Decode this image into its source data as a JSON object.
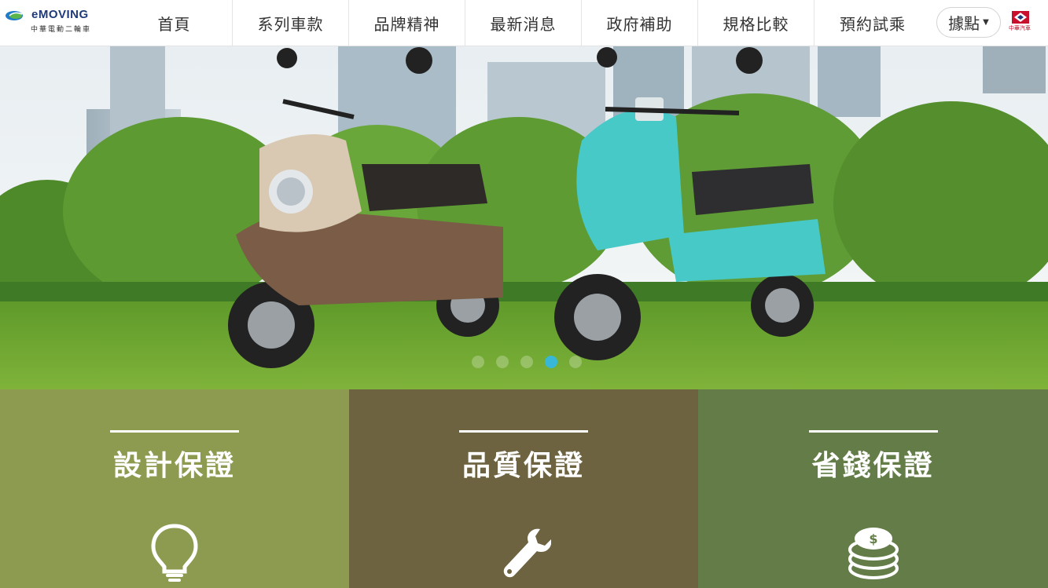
{
  "header": {
    "logo_text": "eMOVING",
    "logo_subtitle": "中華電動二輪車",
    "nav": [
      {
        "label": "首頁"
      },
      {
        "label": "系列車款"
      },
      {
        "label": "品牌精神"
      },
      {
        "label": "最新消息"
      },
      {
        "label": "政府補助"
      },
      {
        "label": "規格比較"
      },
      {
        "label": "預約試乘"
      }
    ],
    "locate_label": "據點",
    "partner_logo_text": "中華汽車"
  },
  "hero": {
    "slide_count": 5,
    "active_slide": 4
  },
  "features": [
    {
      "title": "設計保證",
      "icon": "lightbulb-icon",
      "color": "#8d9b50"
    },
    {
      "title": "品質保證",
      "icon": "wrench-icon",
      "color": "#6d6340"
    },
    {
      "title": "省錢保證",
      "icon": "coin-stack-icon",
      "color": "#647d48"
    }
  ],
  "colors": {
    "accent": "#39b7d6",
    "logo_blue": "#1f3a7a",
    "logo_green": "#5bb54a",
    "partner_red": "#c8102e"
  }
}
